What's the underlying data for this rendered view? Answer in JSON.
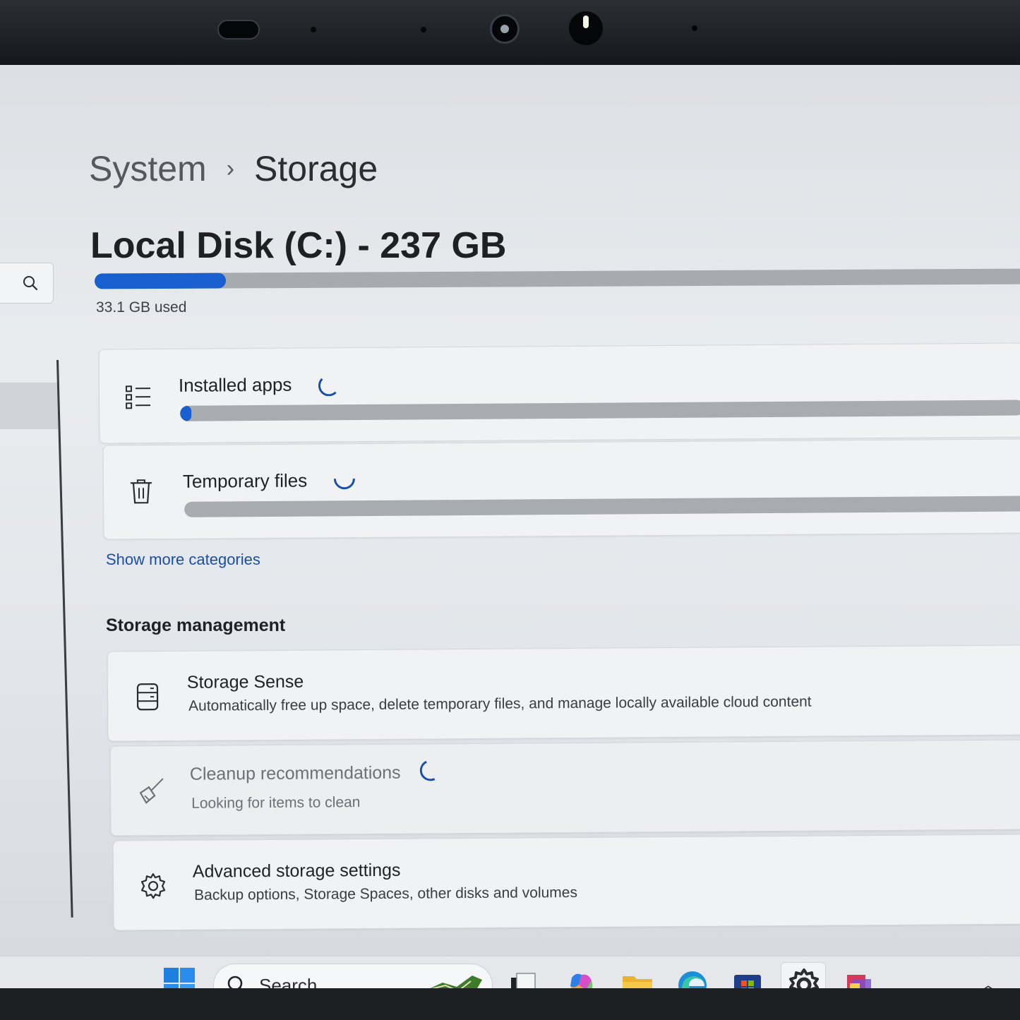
{
  "breadcrumb": {
    "root": "System",
    "separator": "›",
    "current": "Storage"
  },
  "disk": {
    "title": "Local Disk (C:) - 237 GB",
    "used_label": "33.1 GB used",
    "used_fraction": 0.14
  },
  "categories": {
    "installed_apps": {
      "label": "Installed apps",
      "fraction": 0.01,
      "icon": "list-icon",
      "loading": true
    },
    "temporary_files": {
      "label": "Temporary files",
      "fraction": 0.0,
      "icon": "trash-icon",
      "loading": true
    },
    "show_more": "Show more categories"
  },
  "storage_management": {
    "heading": "Storage management",
    "items": [
      {
        "title": "Storage Sense",
        "subtitle": "Automatically free up space, delete temporary files, and manage locally available cloud content",
        "icon": "storage-sense-icon"
      },
      {
        "title": "Cleanup recommendations",
        "subtitle": "Looking for items to clean",
        "icon": "broom-icon",
        "loading": true
      },
      {
        "title": "Advanced storage settings",
        "subtitle": "Backup options, Storage Spaces, other disks and volumes",
        "icon": "gear-icon"
      }
    ]
  },
  "taskbar": {
    "search_placeholder": "Search",
    "apps": [
      "start-icon",
      "task-view-icon",
      "copilot-icon",
      "file-explorer-icon",
      "edge-icon",
      "store-icon",
      "settings-icon",
      "app-icon"
    ],
    "active_app": "settings-icon"
  },
  "colors": {
    "accent": "#1a5fd0",
    "link": "#1a4fa8"
  }
}
